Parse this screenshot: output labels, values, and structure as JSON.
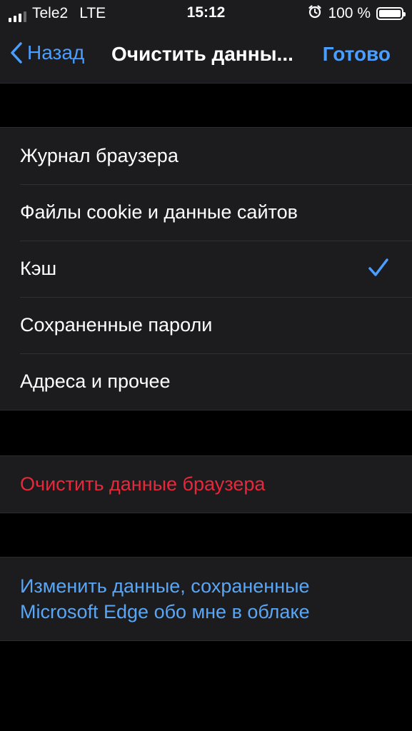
{
  "status_bar": {
    "carrier": "Tele2",
    "network": "LTE",
    "time": "15:12",
    "battery": "100 %",
    "icons": [
      "signal-icon",
      "alarm-icon",
      "battery-icon"
    ]
  },
  "nav": {
    "back_label": "Назад",
    "title": "Очистить данны...",
    "done_label": "Готово",
    "accent_color": "#4a9eff"
  },
  "data_types": [
    {
      "label": "Журнал браузера",
      "checked": false
    },
    {
      "label": "Файлы cookie и данные сайтов",
      "checked": false
    },
    {
      "label": "Кэш",
      "checked": true
    },
    {
      "label": "Сохраненные пароли",
      "checked": false
    },
    {
      "label": "Адреса и прочее",
      "checked": false
    }
  ],
  "clear_action": {
    "label": "Очистить данные браузера",
    "color": "#e8283a"
  },
  "cloud_link": {
    "line1": "Изменить данные, сохраненные",
    "line2": "Microsoft Edge обо мне в облаке",
    "color": "#5aa6f5"
  }
}
